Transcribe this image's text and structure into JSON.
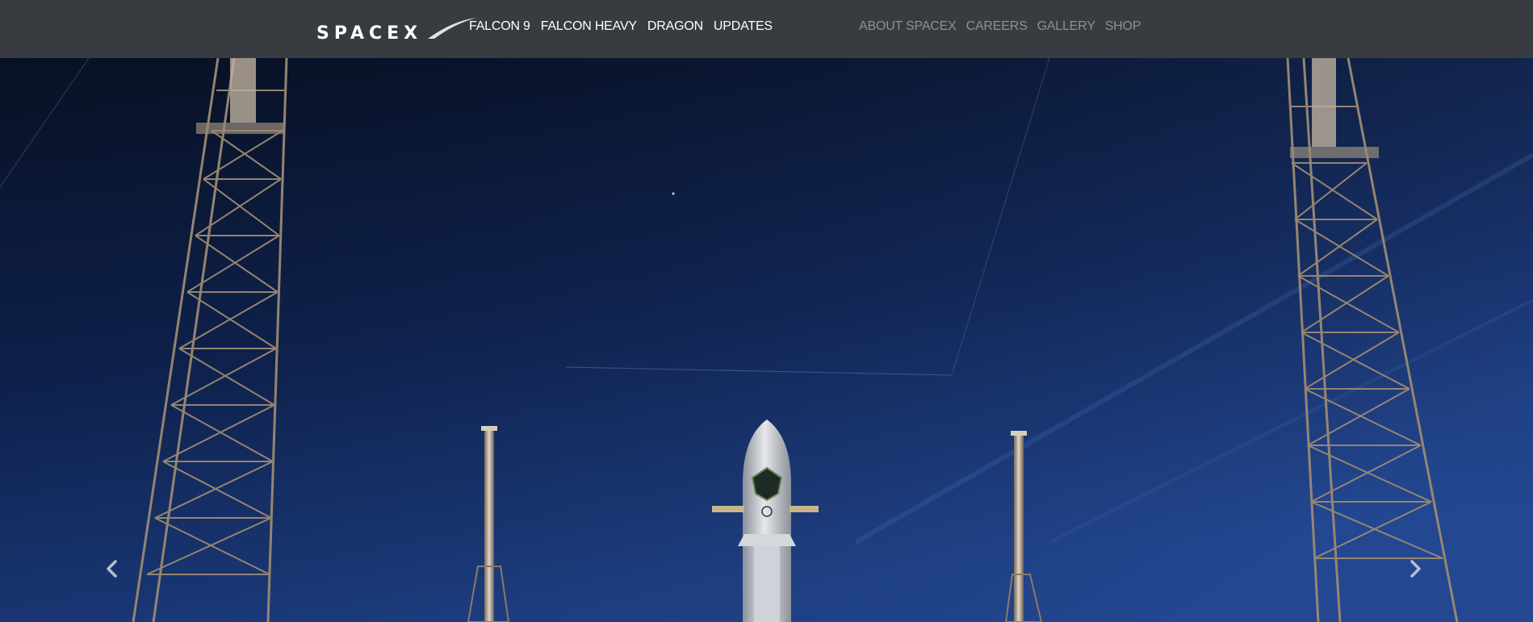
{
  "brand": {
    "logo_text": "SPACEX"
  },
  "primary_nav": [
    {
      "label": "FALCON 9"
    },
    {
      "label": "FALCON HEAVY"
    },
    {
      "label": "DRAGON"
    },
    {
      "label": "UPDATES"
    }
  ],
  "secondary_nav": [
    {
      "label": "ABOUT SPACEX"
    },
    {
      "label": "CAREERS"
    },
    {
      "label": "GALLERY"
    },
    {
      "label": "SHOP"
    }
  ],
  "hero": {
    "carousel_prev_icon": "chevron-left-icon",
    "carousel_next_icon": "chevron-right-icon"
  },
  "colors": {
    "navbar_bg": "#383b3f",
    "nav_primary": "#ffffff",
    "nav_secondary": "#8d9096",
    "sky_top": "#0a1328",
    "sky_bottom": "#1a3a7a"
  }
}
